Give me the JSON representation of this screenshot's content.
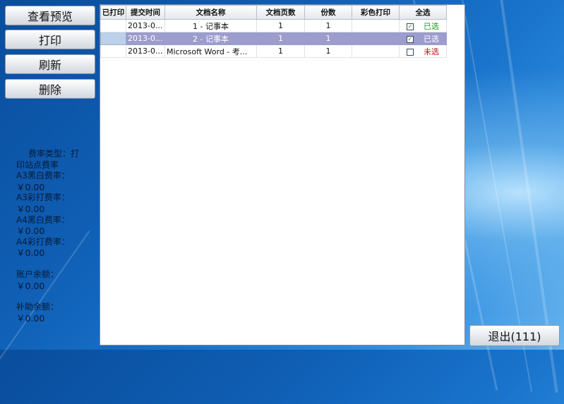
{
  "buttons": {
    "preview": "查看预览",
    "print": "打印",
    "refresh": "刷新",
    "delete": "删除",
    "exit": "退出(111)"
  },
  "rates": {
    "type_label_1": "费率类型：打",
    "type_label_2": "印站点费率",
    "a3_bw_label": "A3黑白费率：",
    "a3_bw_value": "￥0.00",
    "a3_color_label": "A3彩打费率：",
    "a3_color_value": "￥0.00",
    "a4_bw_label": "A4黑白费率：",
    "a4_bw_value": "￥0.00",
    "a4_color_label": "A4彩打费率：",
    "a4_color_value": "￥0.00",
    "balance_label": "账户余额：",
    "balance_value": "￥0.00",
    "subsidy_label": "补助余额：",
    "subsidy_value": "￥0.00"
  },
  "table": {
    "headers": [
      "已打印",
      "提交时间",
      "文档名称",
      "文档页数",
      "份数",
      "彩色打印",
      "全选"
    ],
    "rows": [
      {
        "printed": "",
        "time": "2013-0...",
        "name": "1 - 记事本",
        "pages": "1",
        "copies": "1",
        "color": "",
        "checked": true,
        "status": "已选"
      },
      {
        "printed": "",
        "time": "2013-0...",
        "name": "2 - 记事本",
        "pages": "1",
        "copies": "1",
        "color": "",
        "checked": true,
        "status": "已选"
      },
      {
        "printed": "",
        "time": "2013-0...",
        "name": "Microsoft Word - 考...",
        "pages": "1",
        "copies": "1",
        "color": "",
        "checked": false,
        "status": "未选"
      }
    ]
  },
  "colors": {
    "selected_row": "#9c9ccd",
    "status_selected": "#1e9a1e",
    "status_unselected": "#c0151a"
  }
}
